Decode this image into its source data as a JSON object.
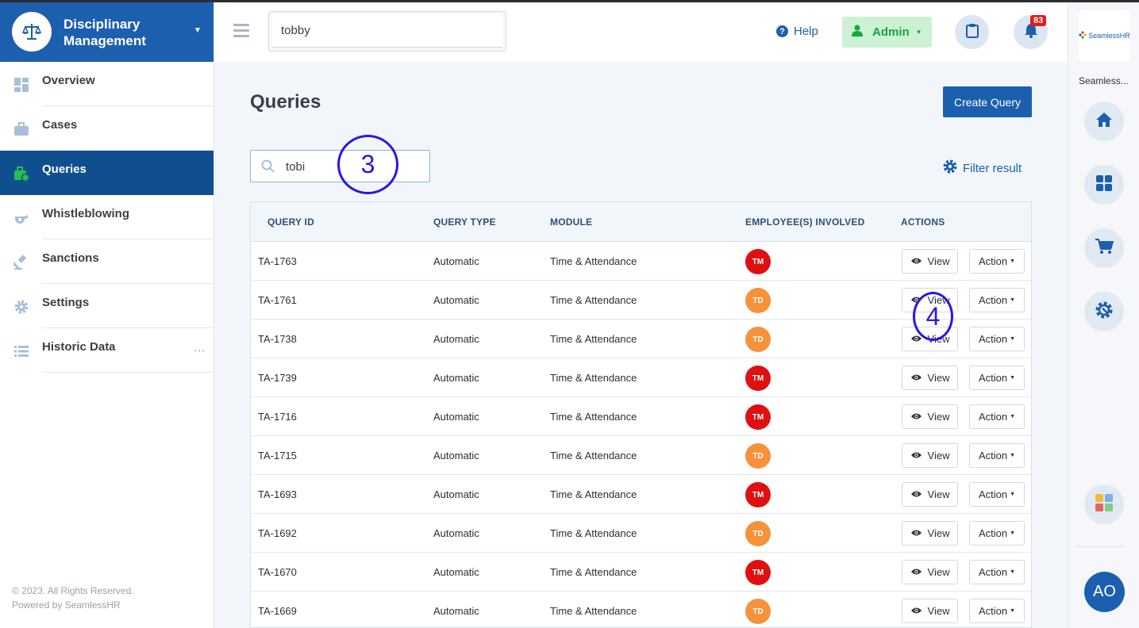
{
  "sidebar": {
    "brand_title": "Disciplinary Management",
    "items": [
      {
        "label": "Overview",
        "icon": "grid-icon"
      },
      {
        "label": "Cases",
        "icon": "briefcase-icon"
      },
      {
        "label": "Queries",
        "icon": "briefcase-clock-icon",
        "active": true
      },
      {
        "label": "Whistleblowing",
        "icon": "whistle-icon"
      },
      {
        "label": "Sanctions",
        "icon": "gavel-icon"
      },
      {
        "label": "Settings",
        "icon": "gear-icon"
      },
      {
        "label": "Historic Data",
        "icon": "list-icon",
        "more": "..."
      }
    ],
    "copyright": "© 2023. All Rights Reserved.",
    "powered_by": "Powered by SeamlessHR"
  },
  "header": {
    "search_value": "tobby",
    "help_label": "Help",
    "admin_label": "Admin",
    "notifications_count": "83"
  },
  "rail": {
    "logo_text": "SeamlessHR",
    "app_name": "Seamless...",
    "avatar_initials": "AO"
  },
  "main": {
    "title": "Queries",
    "create_button": "Create Query",
    "search_value": "tobi",
    "filter_label": "Filter result",
    "annotations": [
      "3",
      "4"
    ]
  },
  "table": {
    "columns": [
      "QUERY ID",
      "QUERY TYPE",
      "MODULE",
      "EMPLOYEE(S) INVOLVED",
      "ACTIONS"
    ],
    "view_label": "View",
    "action_label": "Action",
    "rows": [
      {
        "id": "TA-1763",
        "type": "Automatic",
        "module": "Time & Attendance",
        "emp": "TM",
        "emp_color": "#e01010"
      },
      {
        "id": "TA-1761",
        "type": "Automatic",
        "module": "Time & Attendance",
        "emp": "TD",
        "emp_color": "#f7923a"
      },
      {
        "id": "TA-1738",
        "type": "Automatic",
        "module": "Time & Attendance",
        "emp": "TD",
        "emp_color": "#f7923a"
      },
      {
        "id": "TA-1739",
        "type": "Automatic",
        "module": "Time & Attendance",
        "emp": "TM",
        "emp_color": "#e01010"
      },
      {
        "id": "TA-1716",
        "type": "Automatic",
        "module": "Time & Attendance",
        "emp": "TM",
        "emp_color": "#e01010"
      },
      {
        "id": "TA-1715",
        "type": "Automatic",
        "module": "Time & Attendance",
        "emp": "TD",
        "emp_color": "#f7923a"
      },
      {
        "id": "TA-1693",
        "type": "Automatic",
        "module": "Time & Attendance",
        "emp": "TM",
        "emp_color": "#e01010"
      },
      {
        "id": "TA-1692",
        "type": "Automatic",
        "module": "Time & Attendance",
        "emp": "TD",
        "emp_color": "#f7923a"
      },
      {
        "id": "TA-1670",
        "type": "Automatic",
        "module": "Time & Attendance",
        "emp": "TM",
        "emp_color": "#e01010"
      },
      {
        "id": "TA-1669",
        "type": "Automatic",
        "module": "Time & Attendance",
        "emp": "TD",
        "emp_color": "#f7923a"
      }
    ]
  },
  "colors": {
    "brand": "#1c5fae",
    "active_nav": "#104f8f",
    "admin_bg": "#cdf1d4",
    "admin_text": "#14a83b",
    "badge": "#e31b1b",
    "annotation": "#2a16e8"
  }
}
